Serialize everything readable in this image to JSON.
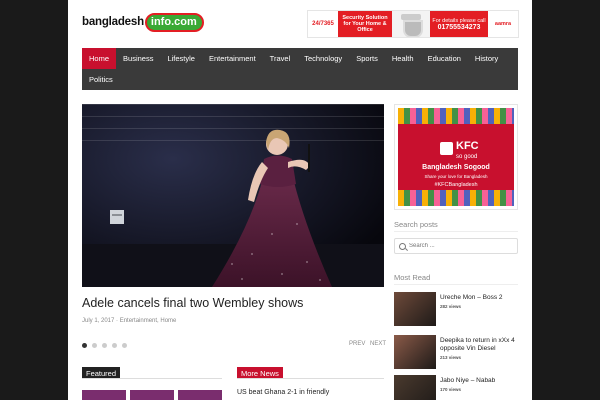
{
  "site": {
    "logo_left": "bangladesh",
    "logo_pill": "info.com"
  },
  "top_ad": {
    "a1": "24/7365",
    "a2": "Security Solution for Your Home & Office",
    "a3_top": "For details please call",
    "a3_phone": "01755534273",
    "a4": "aamra"
  },
  "nav": {
    "row1": [
      "Home",
      "Business",
      "Lifestyle",
      "Entertainment",
      "Travel",
      "Technology",
      "Sports",
      "Health",
      "Education",
      "History"
    ],
    "row2": [
      "Politics"
    ]
  },
  "featured_slide": {
    "headline": "Adele cancels final two Wembley shows",
    "date": "July 1, 2017",
    "categories": "Entertainment, Home",
    "dots": [
      true,
      false,
      false,
      false,
      false
    ],
    "prev": "PREV",
    "next": "NEXT"
  },
  "sections": {
    "featured": "Featured",
    "more_news": "More News",
    "more_news_first": "US beat Ghana 2-1 in friendly"
  },
  "sidebar_ad": {
    "brand": "KFC",
    "tagline": "so good",
    "line1": "Bangladesh Sogood",
    "line2": "Share your love for Bangladesh",
    "line3": "#KFCBangladesh"
  },
  "search": {
    "title": "Search posts",
    "placeholder": "Search ..."
  },
  "most_read": {
    "title": "Most Read",
    "items": [
      {
        "title": "Ureche Mon – Boss 2",
        "views": "282 views",
        "color": "#6e4a3a"
      },
      {
        "title": "Deepika to return in xXx 4 opposite Vin Diesel",
        "views": "213 views",
        "color": "#8a5a48"
      },
      {
        "title": "Jabo Niye – Nabab",
        "views": "170 views",
        "color": "#4a3a2e"
      }
    ]
  },
  "colors": {
    "nav_bg": "#3a3a3a",
    "active": "#c8102e",
    "featured_tag": "#222222",
    "more_news_tag": "#c8102e"
  }
}
